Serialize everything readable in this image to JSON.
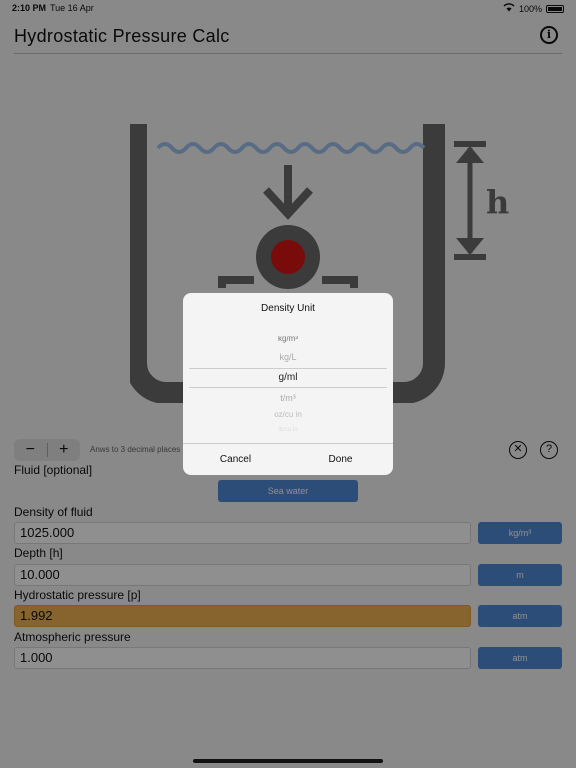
{
  "status_bar": {
    "time": "2:10 PM",
    "date": "Tue 16 Apr",
    "battery": "100%"
  },
  "header": {
    "title": "Hydrostatic Pressure Calc",
    "info_icon": "info-icon"
  },
  "diagram": {
    "height_label": "h"
  },
  "controls": {
    "minus": "−",
    "plus": "+",
    "decimals_note": "Anws to 3 decimal places",
    "clear_icon": "✕",
    "help_icon": "?"
  },
  "fluid": {
    "label": "Fluid [optional]",
    "button": "Sea water"
  },
  "density": {
    "label": "Density of fluid",
    "value": "1025.000",
    "unit": "kg/m³"
  },
  "depth": {
    "label": "Depth [h]",
    "value": "10.000",
    "unit": "m"
  },
  "hydrostatic": {
    "label": "Hydrostatic pressure [p]",
    "value": "1.992",
    "unit": "atm"
  },
  "atmospheric": {
    "label": "Atmospheric pressure",
    "value": "1.000",
    "unit": "atm"
  },
  "dialog": {
    "title": "Density Unit",
    "options": [
      "kg/m³",
      "kg/L",
      "g/ml",
      "t/m³",
      "oz/cu in",
      "lb/cu in"
    ],
    "selected": "g/ml",
    "cancel": "Cancel",
    "done": "Done"
  },
  "colors": {
    "accent_blue": "#4f89d7",
    "result_orange": "#f0b152",
    "ball_red": "#d81414",
    "tank_gray": "#6a6a6a",
    "water_blue": "#9ec1ea"
  }
}
